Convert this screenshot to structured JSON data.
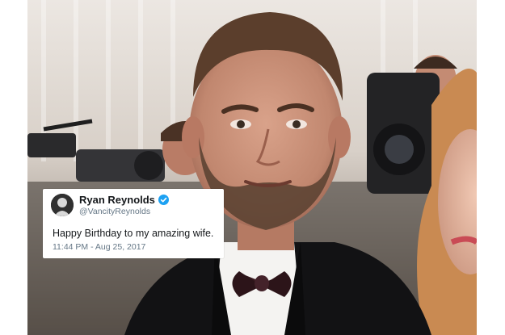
{
  "tweet": {
    "display_name": "Ryan Reynolds",
    "handle": "@VancityReynolds",
    "text": "Happy Birthday to my amazing wife.",
    "timestamp": "11:44 PM - Aug 25, 2017",
    "verified_icon": "verified-badge-icon",
    "accent_color": "#1da1f2"
  },
  "photo": {
    "subject": "man-in-tuxedo-portrait"
  }
}
